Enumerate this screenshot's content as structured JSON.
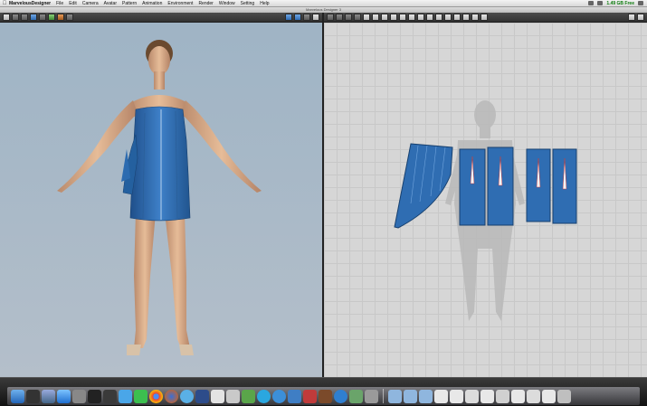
{
  "menubar": {
    "app_name": "MarvelousDesigner",
    "menus": [
      "File",
      "Edit",
      "Camera",
      "Avatar",
      "Pattern",
      "Animation",
      "Environment",
      "Render",
      "Window",
      "Setting",
      "Help"
    ],
    "status": "1.49 GB Free"
  },
  "window": {
    "title": "Marvelous Designer 3"
  },
  "icons": {
    "apple": "apple-icon",
    "avatar": "avatar-female-icon",
    "dress": "blue-dress-icon",
    "patterns": "pattern-panels-icon"
  },
  "colors": {
    "fabric": "#2f6db2",
    "fabric_dark": "#1f4f8a",
    "viewport3d_bg": "#a7b8c7",
    "viewport2d_bg": "#d6d6d6",
    "avatar_silhouette": "#b9b9b9"
  }
}
